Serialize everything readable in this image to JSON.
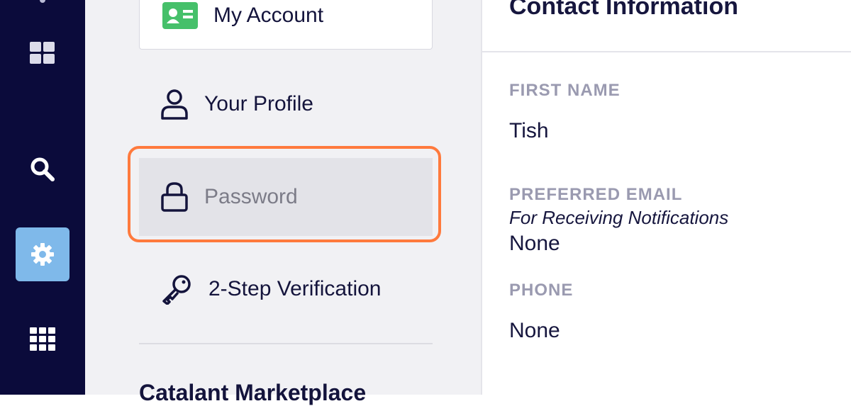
{
  "nav_rail": {
    "items": [
      {
        "name": "dashboard",
        "icon": "dashboard-grid-icon",
        "active": false
      },
      {
        "name": "search",
        "icon": "search-icon",
        "active": false
      },
      {
        "name": "settings",
        "icon": "gear-icon",
        "active": true
      },
      {
        "name": "apps",
        "icon": "apps-grid-icon",
        "active": false
      }
    ],
    "colors": {
      "background": "#0b0b3b",
      "active": "#7fb9ea"
    }
  },
  "settings_menu": {
    "my_account": {
      "label": "My Account",
      "icon": "id-card-icon"
    },
    "items": [
      {
        "label": "Your Profile",
        "icon": "user-icon"
      },
      {
        "label": "Password",
        "icon": "lock-icon",
        "selected": true
      },
      {
        "label": "2-Step Verification",
        "icon": "key-icon"
      }
    ],
    "next_section_title": "Catalant Marketplace"
  },
  "contact": {
    "title": "Contact Information",
    "first_name": {
      "label": "FIRST NAME",
      "value": "Tish"
    },
    "preferred_email": {
      "label": "PREFERRED EMAIL",
      "note": "For Receiving Notifications",
      "value": "None"
    },
    "phone": {
      "label": "PHONE",
      "value": "None"
    }
  },
  "colors": {
    "highlight": "#ff7a3d",
    "heading": "#16163e",
    "label": "#9a9ab0"
  }
}
